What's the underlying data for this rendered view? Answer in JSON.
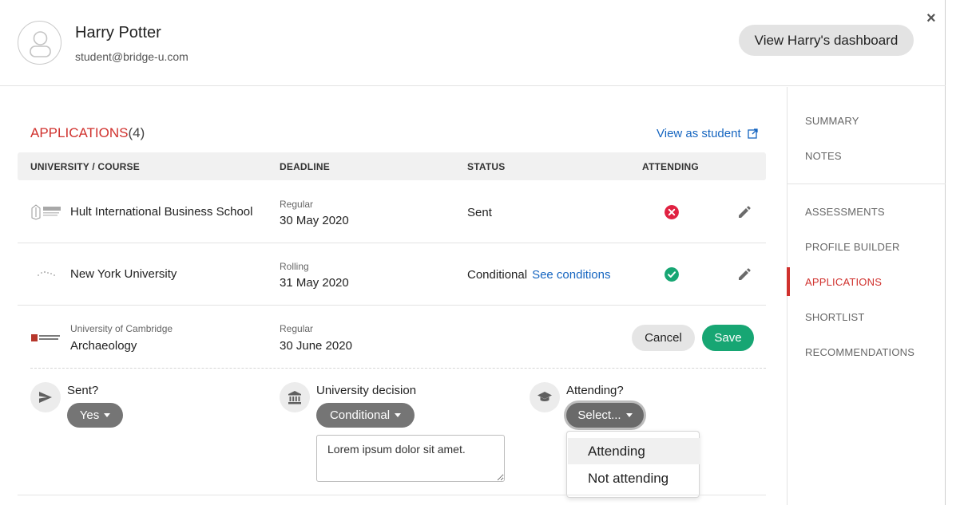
{
  "header": {
    "name": "Harry Potter",
    "email": "student@bridge-u.com",
    "dashboard_button": "View Harry's dashboard",
    "close_label": "×"
  },
  "side_nav": {
    "items": [
      {
        "label": "SUMMARY"
      },
      {
        "label": "NOTES"
      },
      {
        "label": "ASSESSMENTS"
      },
      {
        "label": "PROFILE BUILDER"
      },
      {
        "label": "APPLICATIONS",
        "active": true
      },
      {
        "label": "SHORTLIST"
      },
      {
        "label": "RECOMMENDATIONS"
      }
    ],
    "active_color": "#d0312d"
  },
  "applications": {
    "title": "APPLICATIONS",
    "count": "(4)",
    "view_as_student": "View as student",
    "columns": {
      "course": "UNIVERSITY / COURSE",
      "deadline": "DEADLINE",
      "status": "STATUS",
      "attending": "ATTENDING"
    },
    "rows": [
      {
        "university": "Hult International Business School",
        "deadline_type": "Regular",
        "deadline_date": "30 May 2020",
        "status": "Sent",
        "attending_icon": "error-circle-icon"
      },
      {
        "university": "New York University",
        "deadline_type": "Rolling",
        "deadline_date": "31 May 2020",
        "status": "Conditional",
        "status_link": "See conditions",
        "attending_icon": "check-circle-icon"
      },
      {
        "university": "University of Cambridge",
        "course": "Archaeology",
        "deadline_type": "Regular",
        "deadline_date": "30 June 2020"
      }
    ],
    "edit_row": {
      "cancel_label": "Cancel",
      "save_label": "Save",
      "sent_label": "Sent?",
      "sent_value": "Yes",
      "decision_label": "University decision",
      "decision_value": "Conditional",
      "decision_note": "Lorem ipsum dolor sit amet.",
      "attending_label": "Attending?",
      "attending_value": "Select...",
      "attending_options": [
        "Attending",
        "Not attending"
      ]
    }
  },
  "colors": {
    "accent_red": "#d0312d",
    "link_blue": "#1565c0",
    "success_green": "#17a673",
    "error_red": "#e02141"
  }
}
